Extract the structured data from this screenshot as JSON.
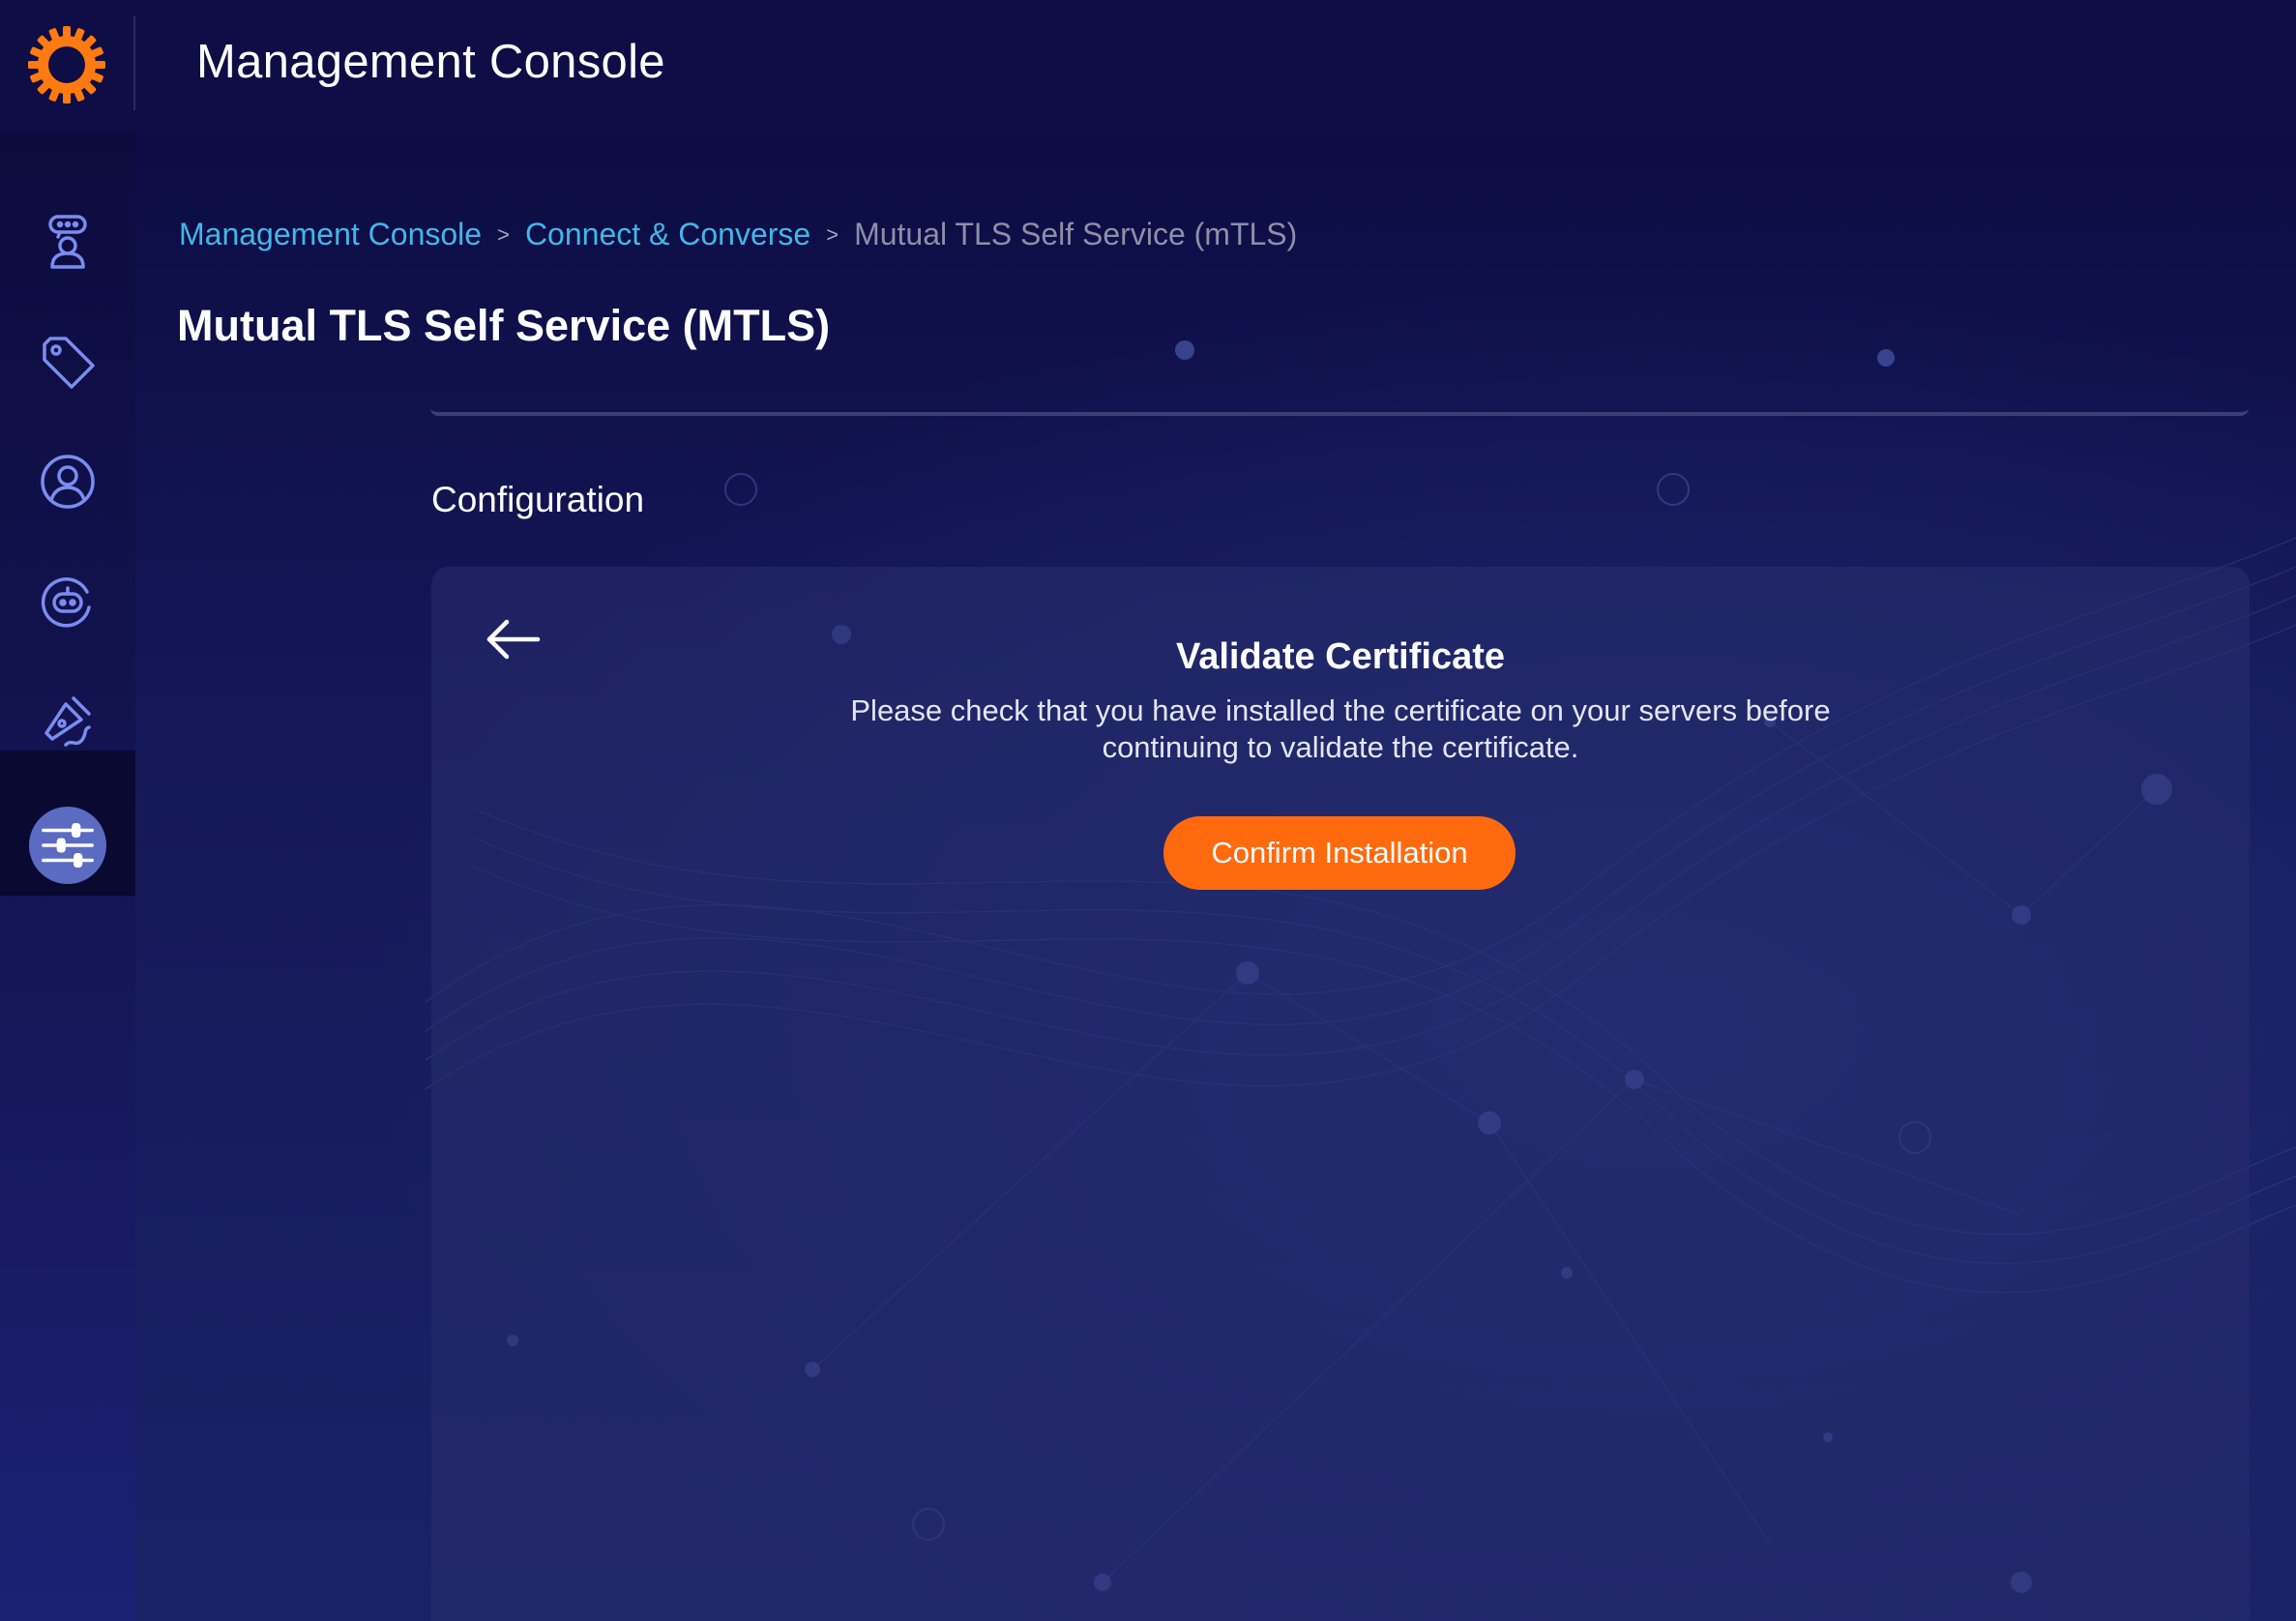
{
  "header": {
    "title": "Management Console",
    "logo_icon": "sun-gear-logo-icon",
    "brand_color": "#ff7a10"
  },
  "sidebar": {
    "items": [
      {
        "icon": "support-agent-icon"
      },
      {
        "icon": "tag-icon"
      },
      {
        "icon": "user-profile-icon"
      },
      {
        "icon": "bot-icon"
      },
      {
        "icon": "pen-tool-icon"
      },
      {
        "icon": "sliders-icon",
        "active": true
      }
    ]
  },
  "breadcrumb": {
    "items": [
      "Management Console",
      "Connect & Converse",
      "Mutual TLS Self Service (mTLS)"
    ],
    "separator": ">"
  },
  "page": {
    "title": "Mutual TLS Self Service (MTLS)",
    "section_label": "Configuration"
  },
  "card": {
    "back_icon": "arrow-left-icon",
    "title": "Validate Certificate",
    "description": "Please check that you have installed the certificate on your servers before continuing to validate the certificate.",
    "confirm_button": "Confirm Installation",
    "button_color": "#ff6a0f"
  }
}
